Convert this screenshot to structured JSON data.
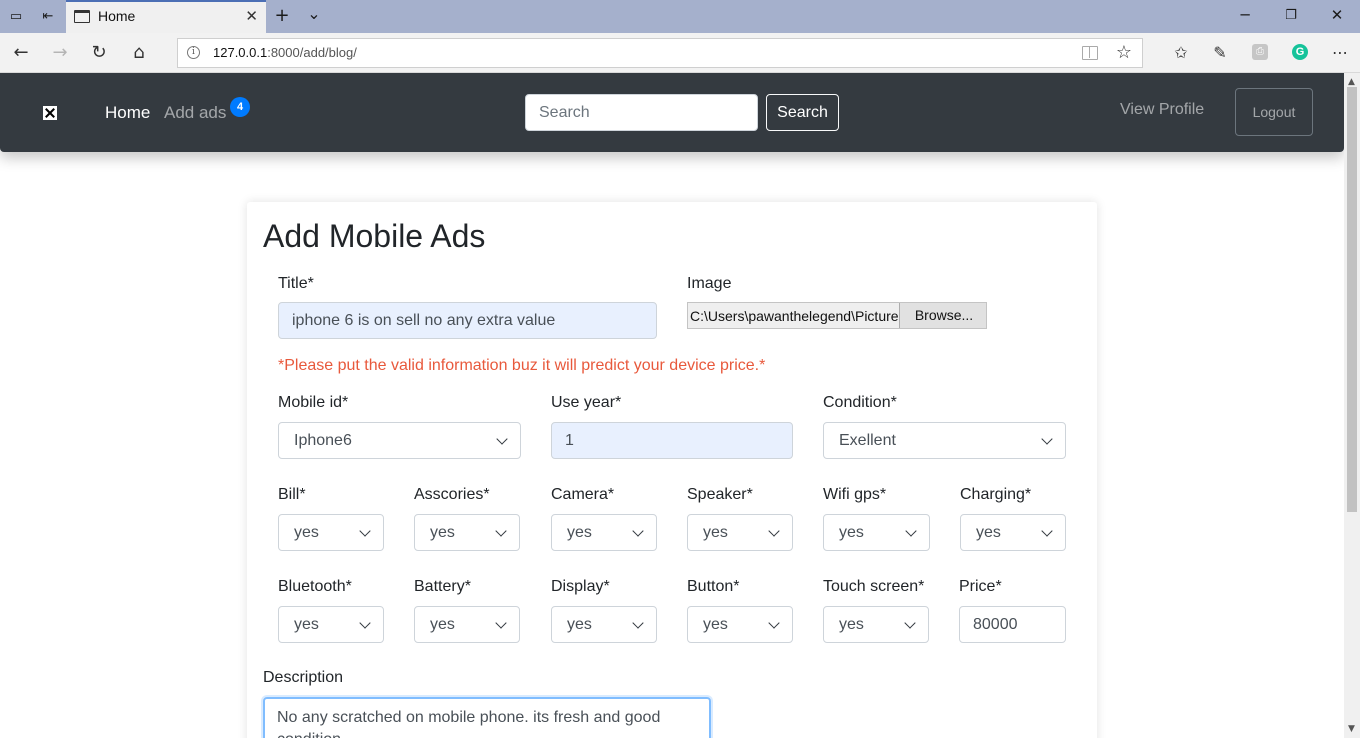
{
  "browser": {
    "tab_title": "Home",
    "url_host": "127.0.0.1",
    "url_path": ":8000/add/blog/",
    "new_tab_glyph": "+",
    "tab_menu_glyph": "⌄"
  },
  "navbar": {
    "home": "Home",
    "add_ads": "Add ads",
    "badge_count": "4",
    "search_placeholder": "Search",
    "search_button": "Search",
    "view_profile": "View Profile",
    "logout": "Logout"
  },
  "form": {
    "title": "Add Mobile Ads",
    "title_label": "Title*",
    "title_value": "iphone 6 is on sell no any extra value",
    "image_label": "Image",
    "image_path": "C:\\Users\\pawanthelegend\\Pictures",
    "browse_button": "Browse...",
    "warning": "*Please put the valid information buz it will predict your device price.*",
    "mobile_id_label": "Mobile id*",
    "mobile_id_value": "Iphone6",
    "use_year_label": "Use year*",
    "use_year_value": "1",
    "condition_label": "Condition*",
    "condition_value": "Exellent",
    "row1": [
      {
        "label": "Bill*",
        "value": "yes"
      },
      {
        "label": "Asscories*",
        "value": "yes"
      },
      {
        "label": "Camera*",
        "value": "yes"
      },
      {
        "label": "Speaker*",
        "value": "yes"
      },
      {
        "label": "Wifi gps*",
        "value": "yes"
      },
      {
        "label": "Charging*",
        "value": "yes"
      }
    ],
    "row2": [
      {
        "label": "Bluetooth*",
        "value": "yes"
      },
      {
        "label": "Battery*",
        "value": "yes"
      },
      {
        "label": "Display*",
        "value": "yes"
      },
      {
        "label": "Button*",
        "value": "yes"
      }
    ],
    "touch_label": "Touch screen*",
    "touch_value": "yes",
    "price_label": "Price*",
    "price_value": "80000",
    "description_label": "Description",
    "description_value": "No any scratched on mobile phone. its fresh and good condition"
  },
  "colors": {
    "navbar_bg": "#343a40",
    "badge": "#007bff",
    "warning_text": "#e8593c",
    "autofill_bg": "#e8f0fe"
  }
}
